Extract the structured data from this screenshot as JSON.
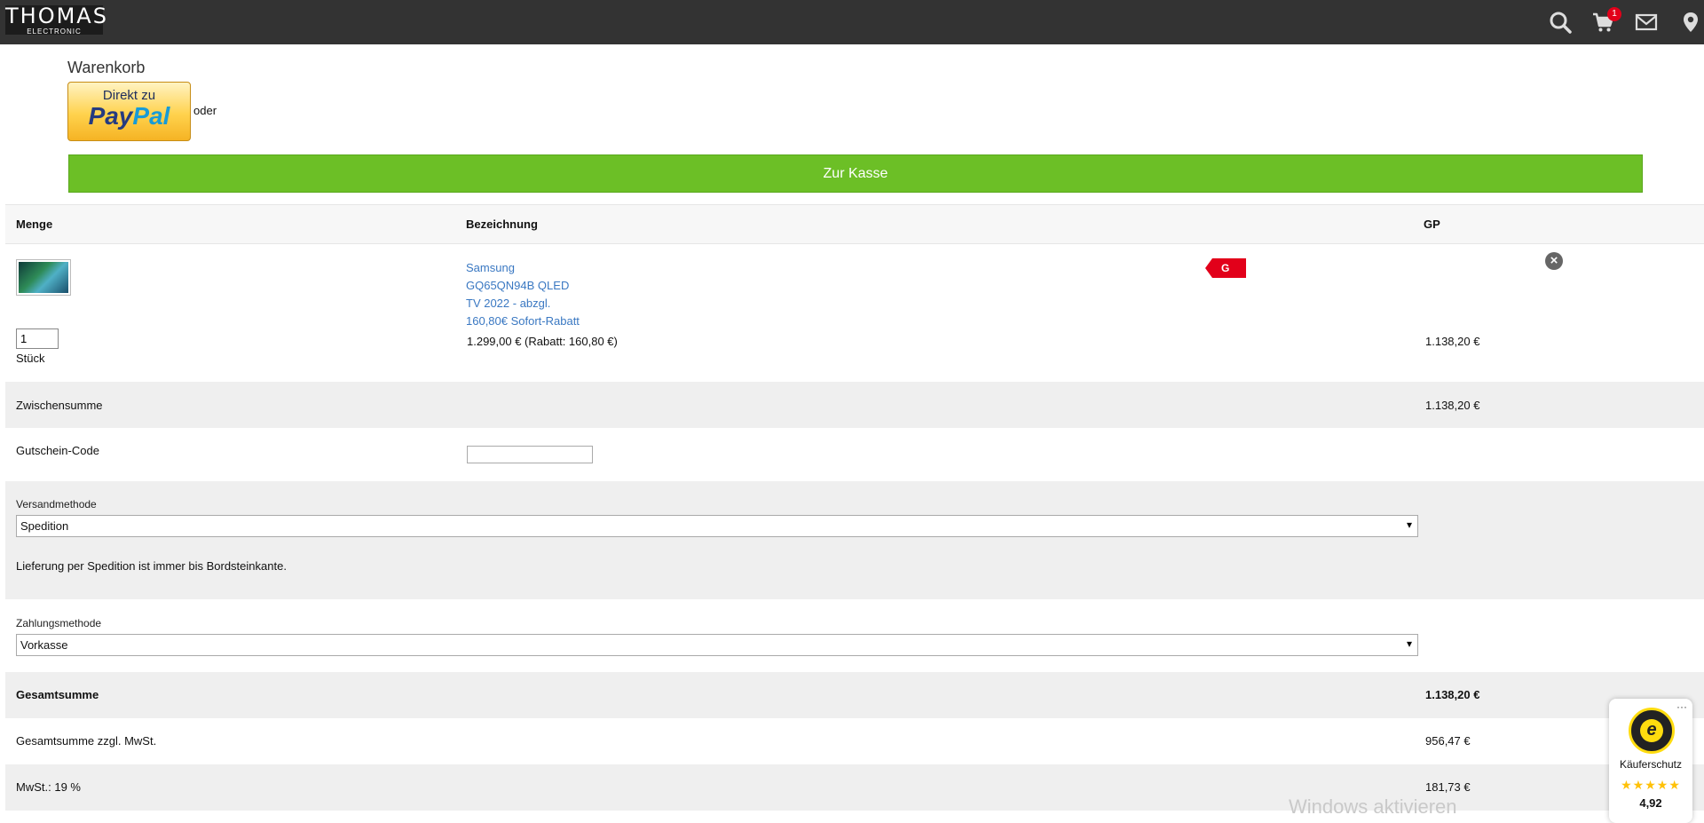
{
  "header": {
    "logo_main": "THOMAS",
    "logo_sub": "ELECTRONIC",
    "cart_count": "1",
    "icons": [
      "search-icon",
      "cart-icon",
      "mail-icon",
      "location-pin-icon"
    ]
  },
  "cart": {
    "title": "Warenkorb",
    "paypal_top": "Direkt zu",
    "paypal_pay": "Pay",
    "paypal_pal": "Pal",
    "or_label": "oder",
    "checkout_label": "Zur Kasse",
    "colors": {
      "checkout": "#6cbf26",
      "header": "#333333",
      "link": "#3a78c2",
      "tag": "#e2001a"
    }
  },
  "table": {
    "col_qty": "Menge",
    "col_name": "Bezeichnung",
    "col_total": "GP"
  },
  "item": {
    "name_lines": [
      "Samsung",
      "GQ65QN94B QLED",
      "TV 2022 - abzgl.",
      "160,80€ Sofort-Rabatt"
    ],
    "price_detail": "1.299,00 € (Rabatt: 160,80 €)",
    "qty": "1",
    "unit": "Stück",
    "total": "1.138,20 €",
    "tag": "G",
    "remove_icon": "close-circle-icon"
  },
  "summary": {
    "subtotal_label": "Zwischensumme",
    "subtotal_value": "1.138,20 €",
    "coupon_label": "Gutschein-Code",
    "shipping_label": "Versandmethode",
    "shipping_value": "Spedition",
    "shipping_note": "Lieferung per Spedition ist immer bis Bordsteinkante.",
    "payment_label": "Zahlungsmethode",
    "payment_value": "Vorkasse",
    "total_label": "Gesamtsumme",
    "total_value": "1.138,20 €",
    "net_label": "Gesamtsumme zzgl. MwSt.",
    "net_value": "956,47 €",
    "vat_label": "MwSt.: 19 %",
    "vat_value": "181,73 €"
  },
  "trusted_shops": {
    "seal_letter": "e",
    "label": "Käuferschutz",
    "stars": "★★★★★",
    "score": "4,92",
    "more": "···"
  },
  "overlay": {
    "watermark": "Windows aktivieren"
  }
}
